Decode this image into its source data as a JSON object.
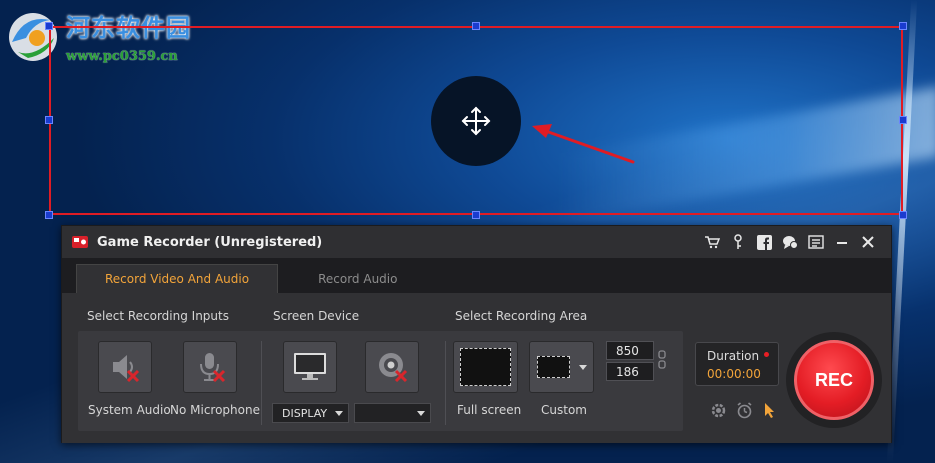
{
  "watermark": {
    "title": "河东软件园",
    "url": "www.pc0359.cn"
  },
  "window": {
    "title": "Game Recorder (Unregistered)",
    "title_icons": [
      "cart-icon",
      "key-icon",
      "facebook-icon",
      "chat-icon",
      "menu-icon",
      "minimize-icon",
      "close-icon"
    ]
  },
  "tabs": [
    {
      "label": "Record Video And Audio",
      "active": true
    },
    {
      "label": "Record Audio",
      "active": false
    }
  ],
  "sections": {
    "inputs": "Select Recording Inputs",
    "screen": "Screen Device",
    "area": "Select Recording Area"
  },
  "inputs": {
    "system_audio": "System Audio",
    "microphone": "No Microphone"
  },
  "screen": {
    "display_select": "DISPLAY",
    "camera_select": ""
  },
  "area": {
    "full_screen": "Full screen",
    "custom": "Custom",
    "width": "850",
    "height": "186"
  },
  "duration": {
    "label": "Duration",
    "time": "00:00:00"
  },
  "rec_label": "REC",
  "colors": {
    "accent": "#f2a43a",
    "rec": "#e41d25",
    "selection": "#e01c24",
    "handle": "#1a3ccf"
  }
}
